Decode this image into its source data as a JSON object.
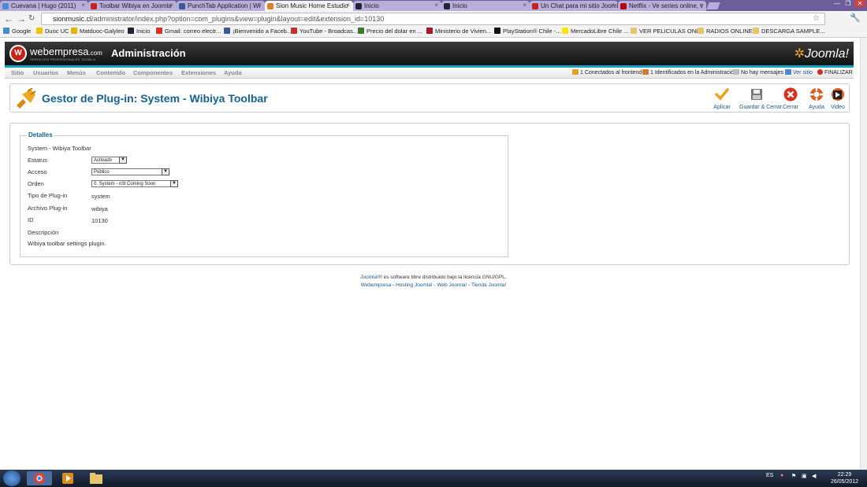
{
  "browser": {
    "tabs": [
      {
        "label": "Cuevana | Hugo (2011)",
        "active": false
      },
      {
        "label": "Toolbar Wibiya en Joomla",
        "active": false
      },
      {
        "label": "PunchTab Application | Wi",
        "active": false
      },
      {
        "label": "Sion Music Home Estudio",
        "active": true
      },
      {
        "label": "Inicio",
        "active": false
      },
      {
        "label": "Inicio",
        "active": false
      },
      {
        "label": "Un Chat para mi sitio Jooml",
        "active": false
      },
      {
        "label": "Netflix - Ve series online, v",
        "active": false
      }
    ],
    "url_host": "sionmusic.cl",
    "url_path": "/administrator/index.php?option=com_plugins&view=plugin&layout=edit&extension_id=10130",
    "bookmarks": [
      "Google",
      "Duoc UC",
      "Matduoc-Galyleo",
      "Inicio",
      "Gmail: correo electr...",
      "¡Bienvenido a Faceb...",
      "YouTube - Broadcas...",
      "Precio del dolar en ...",
      "Ministerio de Vivien...",
      "PlayStation® Chile -...",
      "MercadoLibre Chile ...",
      "VER PELICULAS ONL...",
      "RADIOS ONLINE",
      "DESCARGA SAMPLE..."
    ]
  },
  "header": {
    "brand": "webempresa",
    "brand_suffix": ".com",
    "brand_sub": "SERVICIOS PROFESIONALES JOOMLA",
    "title": "Administración",
    "joomla_logo": "Joomla!"
  },
  "menu": {
    "items": [
      "Sitio",
      "Usuarios",
      "Menús",
      "Contenido",
      "Componentes",
      "Extensiones",
      "Ayuda"
    ],
    "status": {
      "frontend": "1 Conectados al frontend",
      "admin": "1 Identificados en la Administración",
      "messages": "No hay mensajes",
      "view_site": "Ver sitio",
      "logout": "FINALIZAR"
    }
  },
  "toolbar": {
    "title": "Gestor de Plug-in: System - Wibiya Toolbar",
    "apply": "Aplicar",
    "save_close": "Guardar & Cerrar",
    "close": "Cerrar",
    "help": "Ayuda",
    "video": "Video"
  },
  "details": {
    "legend": "Detalles",
    "heading": "System - Wibiya Toolbar",
    "status_label": "Estatus",
    "status_value": "Activado",
    "access_label": "Acceso",
    "access_value": "Público",
    "order_label": "Orden",
    "order_value": "0. System - n3t Coming Soon",
    "type_label": "Tipo de Plug-in",
    "type_value": "system",
    "file_label": "Archivo Plug-in",
    "file_value": "wibiya",
    "id_label": "ID",
    "id_value": "10130",
    "desc_label": "Descripción",
    "desc_value": "Wibiya toolbar settings plugin."
  },
  "footer": {
    "joomla": "Joomla!®",
    "license_text": " es software libre distribuido bajo la licencia GNU/GPL.",
    "links": [
      "Webempresa",
      "Hosting Joomla!",
      "Web Joomla!",
      "Tienda Joomla!"
    ]
  },
  "taskbar": {
    "lang": "ES",
    "time": "22:29",
    "date": "26/05/2012"
  }
}
